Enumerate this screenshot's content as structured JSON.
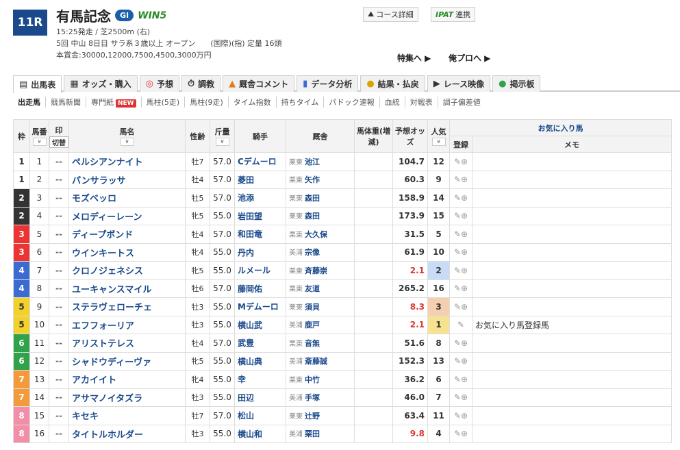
{
  "race": {
    "number": "11R",
    "name": "有馬記念",
    "grade": "GI",
    "win5": "WIN5",
    "line1": "15:25発走 / 芝2500m (右)",
    "line2": "5回 中山 8日目 サラ系３歳以上 オープン　　(国際)(指) 定量 16頭",
    "line3": "本賞金:30000,12000,7500,4500,3000万円"
  },
  "buttons": {
    "course": "コース詳細",
    "ipat": "IPAT",
    "ipat_link": "連携",
    "tokushu": "特集へ ▶",
    "orepro": "俺プロへ ▶"
  },
  "tabs": [
    "出馬表",
    "オッズ・購入",
    "予想",
    "調教",
    "厩舎コメント",
    "データ分析",
    "結果・払戻",
    "レース映像",
    "掲示板"
  ],
  "subtabs": [
    "出走馬",
    "競馬新聞",
    "専門紙",
    "馬柱(5走)",
    "馬柱(9走)",
    "タイム指数",
    "持ちタイム",
    "パドック速報",
    "血統",
    "対戦表",
    "調子偏差値"
  ],
  "new_label": "NEW",
  "headers": {
    "waku": "枠",
    "umaban": "馬番",
    "mark": "印",
    "kirikae": "切替",
    "name": "馬名",
    "sex": "性齢",
    "kin": "斤量",
    "jockey": "騎手",
    "trainer": "厩舎",
    "weight": "馬体重(増減)",
    "odds": "予想オッズ",
    "pop": "人気",
    "fav": "お気に入り馬",
    "reg": "登録",
    "memo": "メモ"
  },
  "horses": [
    {
      "waku": "1",
      "num": "1",
      "mark": "--",
      "name": "ペルシアンナイト",
      "sex": "牡7",
      "kin": "57.0",
      "jockey": "Cデムーロ",
      "region": "栗東",
      "trainer": "池江",
      "odds": "104.7",
      "pop": "12",
      "memo": ""
    },
    {
      "waku": "1",
      "num": "2",
      "mark": "--",
      "name": "パンサラッサ",
      "sex": "牡4",
      "kin": "57.0",
      "jockey": "菱田",
      "region": "栗東",
      "trainer": "矢作",
      "odds": "60.3",
      "pop": "9",
      "memo": ""
    },
    {
      "waku": "2",
      "num": "3",
      "mark": "--",
      "name": "モズベッロ",
      "sex": "牡5",
      "kin": "57.0",
      "jockey": "池添",
      "region": "栗東",
      "trainer": "森田",
      "odds": "158.9",
      "pop": "14",
      "memo": ""
    },
    {
      "waku": "2",
      "num": "4",
      "mark": "--",
      "name": "メロディーレーン",
      "sex": "牝5",
      "kin": "55.0",
      "jockey": "岩田望",
      "region": "栗東",
      "trainer": "森田",
      "odds": "173.9",
      "pop": "15",
      "memo": ""
    },
    {
      "waku": "3",
      "num": "5",
      "mark": "--",
      "name": "ディープボンド",
      "sex": "牡4",
      "kin": "57.0",
      "jockey": "和田竜",
      "region": "栗東",
      "trainer": "大久保",
      "odds": "31.5",
      "pop": "5",
      "memo": ""
    },
    {
      "waku": "3",
      "num": "6",
      "mark": "--",
      "name": "ウインキートス",
      "sex": "牝4",
      "kin": "55.0",
      "jockey": "丹内",
      "region": "美浦",
      "trainer": "宗像",
      "odds": "61.9",
      "pop": "10",
      "memo": ""
    },
    {
      "waku": "4",
      "num": "7",
      "mark": "--",
      "name": "クロノジェネシス",
      "sex": "牝5",
      "kin": "55.0",
      "jockey": "ルメール",
      "region": "栗東",
      "trainer": "斉藤崇",
      "odds": "2.1",
      "pop": "2",
      "memo": ""
    },
    {
      "waku": "4",
      "num": "8",
      "mark": "--",
      "name": "ユーキャンスマイル",
      "sex": "牡6",
      "kin": "57.0",
      "jockey": "藤岡佑",
      "region": "栗東",
      "trainer": "友道",
      "odds": "265.2",
      "pop": "16",
      "memo": ""
    },
    {
      "waku": "5",
      "num": "9",
      "mark": "--",
      "name": "ステラヴェローチェ",
      "sex": "牡3",
      "kin": "55.0",
      "jockey": "Mデムーロ",
      "region": "栗東",
      "trainer": "須貝",
      "odds": "8.3",
      "pop": "3",
      "memo": ""
    },
    {
      "waku": "5",
      "num": "10",
      "mark": "--",
      "name": "エフフォーリア",
      "sex": "牡3",
      "kin": "55.0",
      "jockey": "横山武",
      "region": "美浦",
      "trainer": "鹿戸",
      "odds": "2.1",
      "pop": "1",
      "memo": "お気に入り馬登録馬"
    },
    {
      "waku": "6",
      "num": "11",
      "mark": "--",
      "name": "アリストテレス",
      "sex": "牡4",
      "kin": "57.0",
      "jockey": "武豊",
      "region": "栗東",
      "trainer": "音無",
      "odds": "51.6",
      "pop": "8",
      "memo": ""
    },
    {
      "waku": "6",
      "num": "12",
      "mark": "--",
      "name": "シャドウディーヴァ",
      "sex": "牝5",
      "kin": "55.0",
      "jockey": "横山典",
      "region": "美浦",
      "trainer": "斎藤誠",
      "odds": "152.3",
      "pop": "13",
      "memo": ""
    },
    {
      "waku": "7",
      "num": "13",
      "mark": "--",
      "name": "アカイイト",
      "sex": "牝4",
      "kin": "55.0",
      "jockey": "幸",
      "region": "栗東",
      "trainer": "中竹",
      "odds": "36.2",
      "pop": "6",
      "memo": ""
    },
    {
      "waku": "7",
      "num": "14",
      "mark": "--",
      "name": "アサマノイタズラ",
      "sex": "牡3",
      "kin": "55.0",
      "jockey": "田辺",
      "region": "美浦",
      "trainer": "手塚",
      "odds": "46.0",
      "pop": "7",
      "memo": ""
    },
    {
      "waku": "8",
      "num": "15",
      "mark": "--",
      "name": "キセキ",
      "sex": "牡7",
      "kin": "57.0",
      "jockey": "松山",
      "region": "栗東",
      "trainer": "辻野",
      "odds": "63.4",
      "pop": "11",
      "memo": ""
    },
    {
      "waku": "8",
      "num": "16",
      "mark": "--",
      "name": "タイトルホルダー",
      "sex": "牡3",
      "kin": "55.0",
      "jockey": "横山和",
      "region": "美浦",
      "trainer": "栗田",
      "odds": "9.8",
      "pop": "4",
      "memo": ""
    }
  ]
}
